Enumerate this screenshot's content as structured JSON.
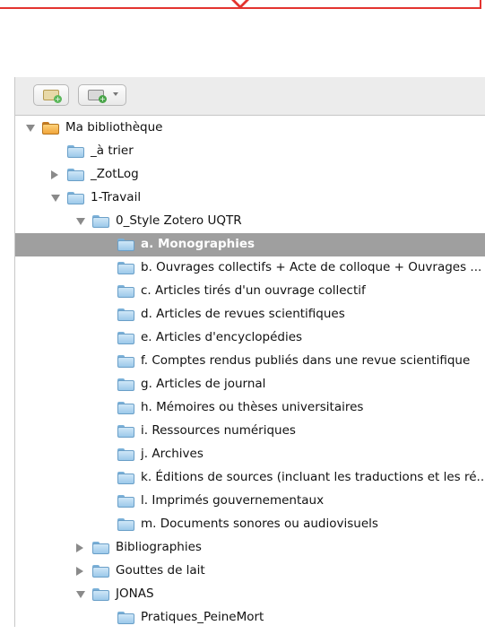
{
  "toolbar": {
    "new_collection_icon": "new-collection-icon",
    "new_library_icon": "new-library-icon"
  },
  "tree": [
    {
      "label": "Ma bibliothèque",
      "level": 0,
      "twisty": "open",
      "kind": "library"
    },
    {
      "label": "_à trier",
      "level": 1,
      "twisty": "none",
      "kind": "folder"
    },
    {
      "label": "_ZotLog",
      "level": 1,
      "twisty": "closed",
      "kind": "folder"
    },
    {
      "label": "1-Travail",
      "level": 1,
      "twisty": "open",
      "kind": "folder"
    },
    {
      "label": "0_Style Zotero UQTR",
      "level": 2,
      "twisty": "open",
      "kind": "folder"
    },
    {
      "label": "a. Monographies",
      "level": 3,
      "twisty": "none",
      "kind": "folder",
      "selected": true
    },
    {
      "label": "b. Ouvrages collectifs + Acte de colloque + Ouvrages ...",
      "level": 3,
      "twisty": "none",
      "kind": "folder"
    },
    {
      "label": "c. Articles tirés d'un ouvrage collectif",
      "level": 3,
      "twisty": "none",
      "kind": "folder"
    },
    {
      "label": "d. Articles de revues scientifiques",
      "level": 3,
      "twisty": "none",
      "kind": "folder"
    },
    {
      "label": "e. Articles d'encyclopédies",
      "level": 3,
      "twisty": "none",
      "kind": "folder"
    },
    {
      "label": "f. Comptes rendus publiés dans une revue scientifique",
      "level": 3,
      "twisty": "none",
      "kind": "folder"
    },
    {
      "label": "g. Articles de journal",
      "level": 3,
      "twisty": "none",
      "kind": "folder"
    },
    {
      "label": "h. Mémoires ou thèses universitaires",
      "level": 3,
      "twisty": "none",
      "kind": "folder"
    },
    {
      "label": "i. Ressources numériques",
      "level": 3,
      "twisty": "none",
      "kind": "folder"
    },
    {
      "label": "j. Archives",
      "level": 3,
      "twisty": "none",
      "kind": "folder"
    },
    {
      "label": "k. Éditions de sources (incluant les traductions et les ré...",
      "level": 3,
      "twisty": "none",
      "kind": "folder"
    },
    {
      "label": "l. Imprimés gouvernementaux",
      "level": 3,
      "twisty": "none",
      "kind": "folder"
    },
    {
      "label": "m. Documents sonores ou audiovisuels",
      "level": 3,
      "twisty": "none",
      "kind": "folder"
    },
    {
      "label": "Bibliographies",
      "level": 2,
      "twisty": "closed",
      "kind": "folder"
    },
    {
      "label": "Gouttes de lait",
      "level": 2,
      "twisty": "closed",
      "kind": "folder"
    },
    {
      "label": "JONAS",
      "level": 2,
      "twisty": "open",
      "kind": "folder"
    },
    {
      "label": "Pratiques_PeineMort",
      "level": 3,
      "twisty": "none",
      "kind": "folder"
    }
  ],
  "colors": {
    "selection": "#9f9f9f",
    "folder": "#9cc9ea",
    "library": "#f0a53a",
    "callout": "#e3342f"
  }
}
